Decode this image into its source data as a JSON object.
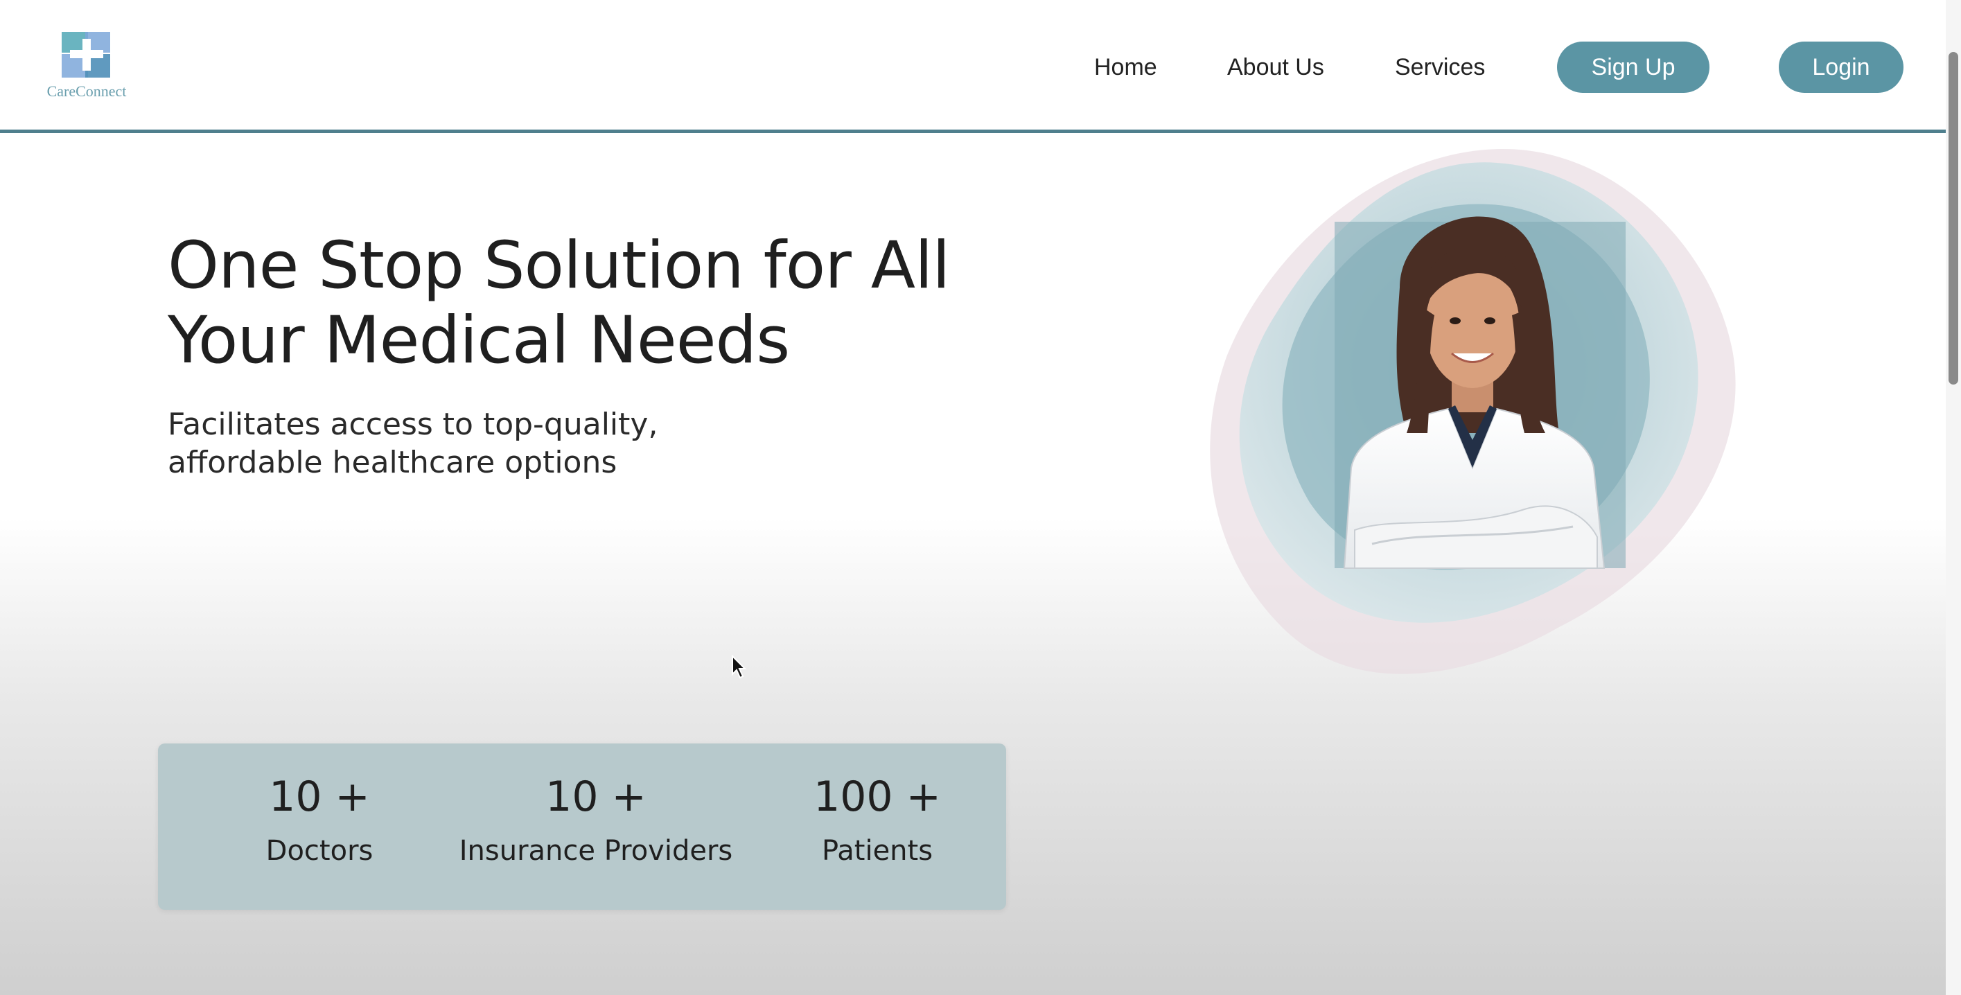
{
  "brand": {
    "name": "CareConnect",
    "accent": "#5b95a4",
    "logo_colors": [
      "#6ab4c0",
      "#7da7d9",
      "#4f8fb8"
    ]
  },
  "nav": {
    "links": [
      "Home",
      "About Us",
      "Services"
    ],
    "signup_label": "Sign Up",
    "login_label": "Login"
  },
  "hero": {
    "title_line1": "One Stop Solution for All",
    "title_line2": "Your Medical Needs",
    "subtitle_line1": "Facilitates access to top-quality,",
    "subtitle_line2": "affordable healthcare options",
    "image": "doctor-portrait-icon"
  },
  "stats": [
    {
      "value": "10 +",
      "label": "Doctors"
    },
    {
      "value": "10 +",
      "label": "Insurance Providers"
    },
    {
      "value": "100 +",
      "label": "Patients"
    }
  ]
}
